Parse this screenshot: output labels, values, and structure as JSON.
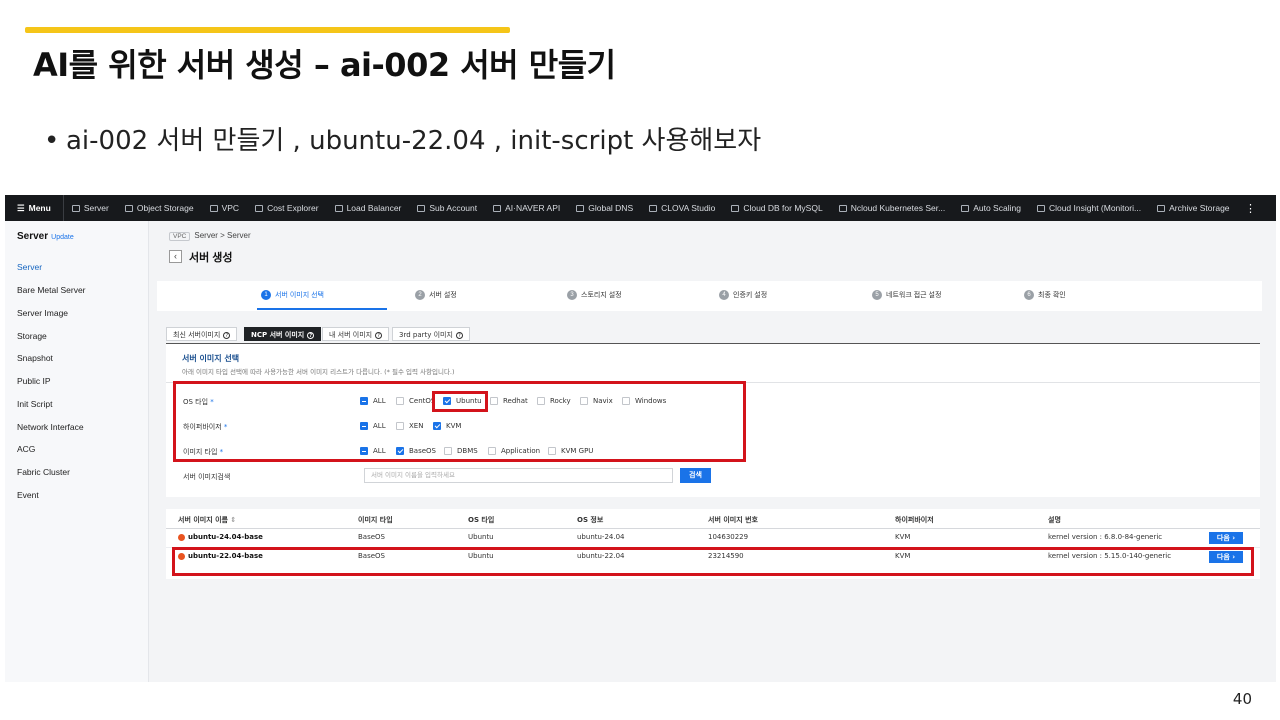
{
  "slide": {
    "title": "AI를 위한 서버 생성 – ai-002 서버 만들기",
    "bullet": "ai-002 서버 만들기 , ubuntu-22.04 , init-script 사용해보자",
    "page_number": "40",
    "accent_color": "#f5c518",
    "highlight_color": "#d3131b"
  },
  "topnav": {
    "menu_label": "Menu",
    "items": [
      "Server",
      "Object Storage",
      "VPC",
      "Cost Explorer",
      "Load Balancer",
      "Sub Account",
      "AI·NAVER API",
      "Global DNS",
      "CLOVA Studio",
      "Cloud DB for MySQL",
      "Ncloud Kubernetes Ser...",
      "Auto Scaling",
      "Cloud Insight (Monitori...",
      "Archive Storage"
    ],
    "more_label": "⋮"
  },
  "sidebar": {
    "title": "Server",
    "badge": "Update",
    "items": [
      "Server",
      "Bare Metal Server",
      "Server Image",
      "Storage",
      "Snapshot",
      "Public IP",
      "Init Script",
      "Network Interface",
      "ACG",
      "Fabric Cluster",
      "Event"
    ]
  },
  "breadcrumb": {
    "vpc": "VPC",
    "path": "Server  >  Server"
  },
  "page": {
    "back_icon": "‹",
    "title": "서버 생성"
  },
  "steps": [
    {
      "num": "1",
      "label": "서버 이미지 선택"
    },
    {
      "num": "2",
      "label": "서버 설정"
    },
    {
      "num": "3",
      "label": "스토리지 설정"
    },
    {
      "num": "4",
      "label": "인증키 설정"
    },
    {
      "num": "5",
      "label": "네트워크 접근 설정"
    },
    {
      "num": "6",
      "label": "최종 확인"
    }
  ],
  "tabs": [
    {
      "label": "최신 서버이미지",
      "q": "?"
    },
    {
      "label": "NCP 서버 이미지",
      "q": "?"
    },
    {
      "label": "내 서버 이미지",
      "q": "?"
    },
    {
      "label": "3rd party 이미지",
      "q": "?"
    }
  ],
  "filter": {
    "title": "서버 이미지 선택",
    "description": "아래 이미지 타입 선택에 따라 사용가능한 서버 이미지 리스트가 다릅니다. (* 필수 입력 사항입니다.)",
    "os_label": "OS 타입",
    "os_options": [
      "ALL",
      "CentOS",
      "Ubuntu",
      "Redhat",
      "Rocky",
      "Navix",
      "Windows"
    ],
    "hypervisor_label": "하이퍼바이저",
    "hypervisor_options": [
      "ALL",
      "XEN",
      "KVM"
    ],
    "image_type_label": "이미지 타입",
    "image_type_options": [
      "ALL",
      "BaseOS",
      "DBMS",
      "Application",
      "KVM GPU"
    ],
    "required_mark": "*",
    "search_label": "서버 이미지검색",
    "search_placeholder": "서버 이미지 이름을 입력하세요",
    "search_button": "검색"
  },
  "table": {
    "headers": [
      "서버 이미지 이름",
      "이미지 타입",
      "OS 타입",
      "OS 정보",
      "서버 이미지 번호",
      "하이퍼바이저",
      "설명"
    ],
    "sort_icon": "⇕",
    "next_label": "다음  ›",
    "rows": [
      {
        "name": "ubuntu-24.04-base",
        "type": "BaseOS",
        "os": "Ubuntu",
        "os_info": "ubuntu-24.04",
        "number": "104630229",
        "hypervisor": "KVM",
        "desc": "kernel version : 6.8.0-84-generic"
      },
      {
        "name": "ubuntu-22.04-base",
        "type": "BaseOS",
        "os": "Ubuntu",
        "os_info": "ubuntu-22.04",
        "number": "23214590",
        "hypervisor": "KVM",
        "desc": "kernel version : 5.15.0-140-generic"
      }
    ]
  }
}
